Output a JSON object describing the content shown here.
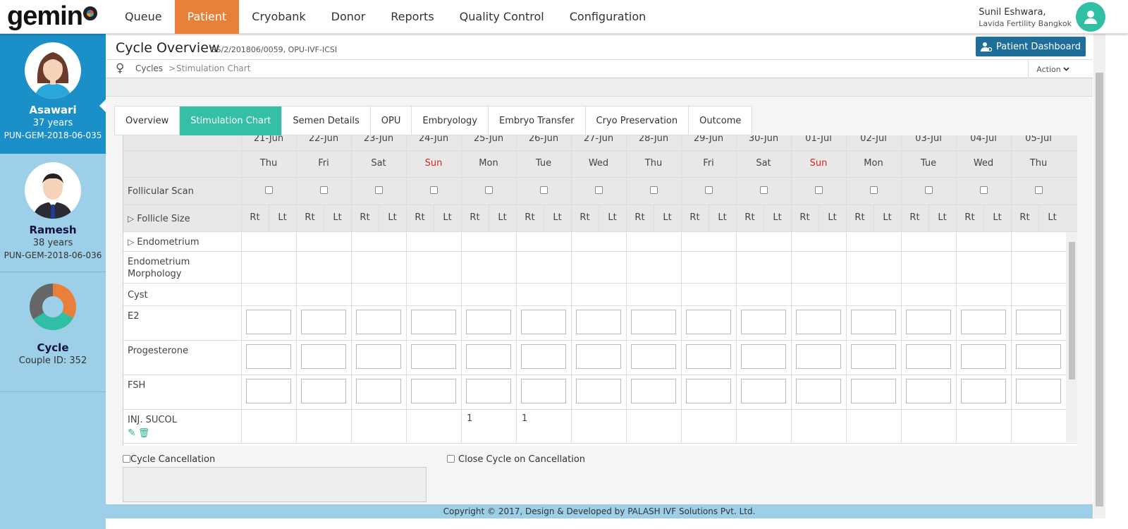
{
  "app": {
    "logo": "gemin",
    "nav": [
      "Queue",
      "Patient",
      "Cryobank",
      "Donor",
      "Reports",
      "Quality Control",
      "Configuration"
    ],
    "active_nav": "Patient",
    "user_name": "Sunil Eshwara,",
    "user_clinic": "Lavida Fertility Bangkok"
  },
  "sidebar": {
    "female": {
      "name": "Asawari",
      "age": "37 years",
      "id": "PUN-GEM-2018-06-035"
    },
    "male": {
      "name": "Ramesh",
      "age": "38 years",
      "id": "PUN-GEM-2018-06-036"
    },
    "cycle": {
      "name": "Cycle",
      "couple": "Couple ID: 352"
    }
  },
  "header": {
    "title": "Cycle Overview",
    "subtitle": "GS/2/201806/0059, OPU-IVF-ICSI",
    "dashboard_button": "Patient Dashboard",
    "breadcrumb": [
      "Cycles",
      ">",
      "Stimulation Chart"
    ],
    "action": "Action"
  },
  "tabs": [
    "Overview",
    "Stimulation Chart",
    "Semen Details",
    "OPU",
    "Embryology",
    "Embryo Transfer",
    "Cryo Preservation",
    "Outcome"
  ],
  "active_tab": "Stimulation Chart",
  "chart": {
    "dates": [
      "21-Jun",
      "22-Jun",
      "23-Jun",
      "24-Jun",
      "25-Jun",
      "26-Jun",
      "27-Jun",
      "28-Jun",
      "29-Jun",
      "30-Jun",
      "01-Jul",
      "02-Jul",
      "03-Jul",
      "04-Jul",
      "05-Jul"
    ],
    "days": [
      "Thu",
      "Fri",
      "Sat",
      "Sun",
      "Mon",
      "Tue",
      "Wed",
      "Thu",
      "Fri",
      "Sat",
      "Sun",
      "Mon",
      "Tue",
      "Wed",
      "Thu"
    ],
    "rows": {
      "follicular_scan": "Follicular Scan",
      "follicle_size": "Follicle Size",
      "endometrium": "Endometrium",
      "endometrium_morphology": "Endometrium Morphology",
      "cyst": "Cyst",
      "e2": "E2",
      "progesterone": "Progesterone",
      "fsh": "FSH",
      "injection": "INJ. SUCOL"
    },
    "rt": "Rt",
    "lt": "Lt",
    "injection_values": [
      "",
      "",
      "",
      "",
      "1",
      "1",
      "",
      "",
      "",
      "",
      "",
      "",
      "",
      "",
      ""
    ],
    "sun_color": "#d9231d"
  },
  "cancel": {
    "cycle_cancellation": "Cycle Cancellation",
    "close_on_cancellation": "Close Cycle on Cancellation"
  },
  "footer": "Copyright © 2017, Design & Developed by PALASH IVF Solutions Pvt. Ltd."
}
